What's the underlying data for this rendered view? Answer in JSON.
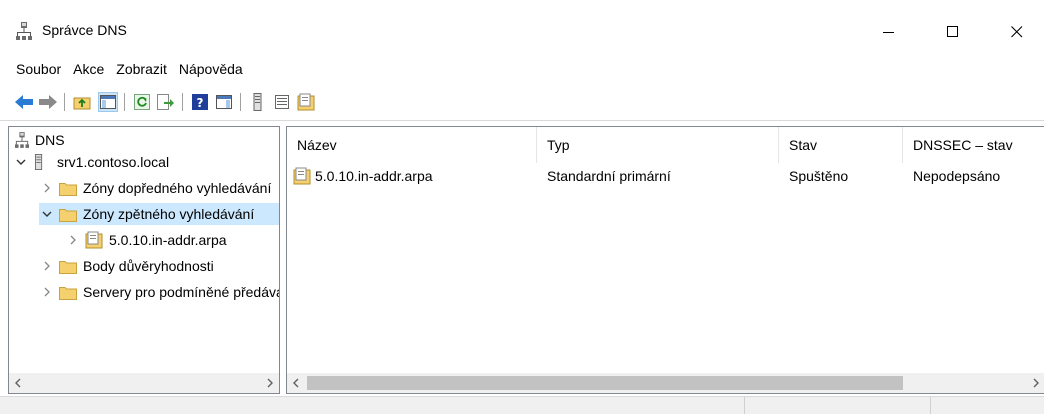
{
  "window": {
    "title": "Správce DNS"
  },
  "menu": [
    "Soubor",
    "Akce",
    "Zobrazit",
    "Nápověda"
  ],
  "tree": {
    "root": "DNS",
    "server": "srv1.contoso.local",
    "items": [
      {
        "label": "Zóny dopředného vyhledávání"
      },
      {
        "label": "Zóny zpětného vyhledávání"
      },
      {
        "label": "5.0.10.in-addr.arpa"
      },
      {
        "label": "Body důvěryhodnosti"
      },
      {
        "label": "Servery pro podmíněné předávání"
      }
    ]
  },
  "list": {
    "columns": [
      "Název",
      "Typ",
      "Stav",
      "DNSSEC – stav"
    ],
    "rows": [
      {
        "name": "5.0.10.in-addr.arpa",
        "type": "Standardní primární",
        "status": "Spuštěno",
        "dnssec": "Nepodepsáno"
      }
    ]
  },
  "colors": {
    "selection": "#cce8ff",
    "folder": "#f4d06f",
    "accent_back": "#2a7bd4"
  }
}
